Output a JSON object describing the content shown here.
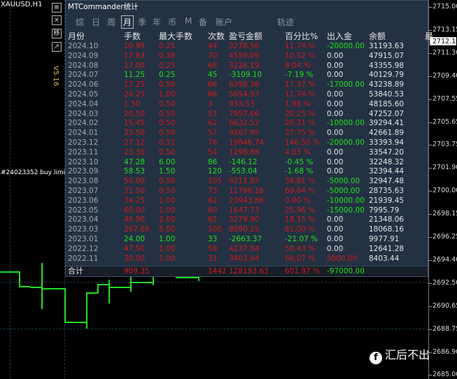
{
  "chart": {
    "symbol": "XAUUSD,H1",
    "version": "V5.16",
    "order_label": "#24023352 buy limit",
    "current_price": "2712.10",
    "price_labels": [
      "2715.00",
      "2713.15",
      "2711.30",
      "2709.40",
      "2707.55",
      "2705.65",
      "2703.75",
      "2701.90",
      "2700.00",
      "2698.15",
      "2696.25",
      "2694.40",
      "2692.50",
      "2690.65",
      "2688.75",
      "2686.90",
      "2685.00"
    ],
    "side_buttons": [
      "≡",
      "×",
      "移",
      "↗"
    ]
  },
  "panel": {
    "title": "MTCommander统计",
    "tabs": [
      "综",
      "日",
      "周",
      "月",
      "季",
      "年",
      "币",
      "M",
      "备",
      "账户",
      "轨迹"
    ],
    "active_tab": "月",
    "headers": [
      "月份",
      "手数",
      "最大手数",
      "次数",
      "盈亏金额",
      "百分比%",
      "出入金",
      "余额",
      "最"
    ],
    "rows": [
      {
        "month": "2024.10",
        "lots": "10.95",
        "max": "0.25",
        "count": "44",
        "pl": "3278.56",
        "pct": "11.74 %",
        "io": "-20000.00",
        "bal": "31193.63",
        "win": false
      },
      {
        "month": "2024.09",
        "lots": "17.63",
        "max": "0.38",
        "count": "70",
        "pl": "4559.09",
        "pct": "10.52 %",
        "io": "0.00",
        "bal": "47915.07",
        "win": false
      },
      {
        "month": "2024.08",
        "lots": "17.00",
        "max": "0.25",
        "count": "68",
        "pl": "3226.19",
        "pct": "8.04 %",
        "io": "0.00",
        "bal": "43355.98",
        "win": false
      },
      {
        "month": "2024.07",
        "lots": "11.25",
        "max": "0.25",
        "count": "45",
        "pl": "-3109.10",
        "pct": "-7.19 %",
        "io": "0.00",
        "bal": "40129.79",
        "win": true
      },
      {
        "month": "2024.06",
        "lots": "17.25",
        "max": "0.50",
        "count": "66",
        "pl": "6398.36",
        "pct": "17.37 %",
        "io": "-17000.00",
        "bal": "43238.89",
        "win": false
      },
      {
        "month": "2024.05",
        "lots": "24.25",
        "max": "1.00",
        "count": "66",
        "pl": "5654.93",
        "pct": "11.74 %",
        "io": "0.00",
        "bal": "53840.53",
        "win": false
      },
      {
        "month": "2024.04",
        "lots": "1.50",
        "max": "0.50",
        "count": "3",
        "pl": "933.53",
        "pct": "1.98 %",
        "io": "0.00",
        "bal": "48185.60",
        "win": false
      },
      {
        "month": "2024.03",
        "lots": "20.50",
        "max": "0.50",
        "count": "53",
        "pl": "7957.66",
        "pct": "20.25 %",
        "io": "0.00",
        "bal": "47252.07",
        "win": false
      },
      {
        "month": "2024.02",
        "lots": "15.45",
        "max": "0.50",
        "count": "62",
        "pl": "6632.52",
        "pct": "20.31 %",
        "io": "-10000.00",
        "bal": "39294.41",
        "win": false
      },
      {
        "month": "2024.01",
        "lots": "25.50",
        "max": "0.50",
        "count": "57",
        "pl": "9267.95",
        "pct": "27.75 %",
        "io": "0.00",
        "bal": "42661.89",
        "win": false
      },
      {
        "month": "2023.12",
        "lots": "27.12",
        "max": "0.52",
        "count": "76",
        "pl": "19846.74",
        "pct": "146.50 %",
        "io": "-20000.00",
        "bal": "33393.94",
        "win": false
      },
      {
        "month": "2023.11",
        "lots": "23.30",
        "max": "0.50",
        "count": "54",
        "pl": "1298.88",
        "pct": "4.03 %",
        "io": "0.00",
        "bal": "33547.20",
        "win": false
      },
      {
        "month": "2023.10",
        "lots": "47.28",
        "max": "6.00",
        "count": "86",
        "pl": "-146.12",
        "pct": "-0.45 %",
        "io": "0.00",
        "bal": "32248.32",
        "win": true
      },
      {
        "month": "2023.09",
        "lots": "58.53",
        "max": "1.50",
        "count": "120",
        "pl": "-553.04",
        "pct": "-1.68 %",
        "io": "0.00",
        "bal": "32394.44",
        "win": true
      },
      {
        "month": "2023.08",
        "lots": "50.00",
        "max": "0.50",
        "count": "105",
        "pl": "9211.85",
        "pct": "38.81 %",
        "io": "-5000.00",
        "bal": "32947.48",
        "win": false
      },
      {
        "month": "2023.07",
        "lots": "31.50",
        "max": "0.50",
        "count": "73",
        "pl": "11796.16",
        "pct": "69.64 %",
        "io": "-5000.00",
        "bal": "28735.63",
        "win": false
      },
      {
        "month": "2023.06",
        "lots": "34.25",
        "max": "1.00",
        "count": "62",
        "pl": "23943.86",
        "pct": "0.00 %",
        "io": "-10000.00",
        "bal": "21939.45",
        "win": false
      },
      {
        "month": "2023.05",
        "lots": "60.00",
        "max": "1.00",
        "count": "60",
        "pl": "1647.73",
        "pct": "25.96 %",
        "io": "-15000.00",
        "bal": "7995.79",
        "win": false
      },
      {
        "month": "2023.04",
        "lots": "46.90",
        "max": "2.00",
        "count": "62",
        "pl": "3279.90",
        "pct": "18.15 %",
        "io": "0.00",
        "bal": "21348.06",
        "win": false
      },
      {
        "month": "2023.03",
        "lots": "267.69",
        "max": "5.00",
        "count": "100",
        "pl": "8090.25",
        "pct": "81.00 %",
        "io": "0.00",
        "bal": "18068.16",
        "win": false
      },
      {
        "month": "2023.01",
        "lots": "24.00",
        "max": "1.00",
        "count": "33",
        "pl": "-2663.37",
        "pct": "-21.07 %",
        "io": "0.00",
        "bal": "9977.91",
        "win": true
      },
      {
        "month": "2022.12",
        "lots": "47.50",
        "max": "1.00",
        "count": "58",
        "pl": "4237.84",
        "pct": "50.43 %",
        "io": "0.00",
        "bal": "12641.28",
        "win": false
      },
      {
        "month": "2022.11",
        "lots": "30.00",
        "max": "1.00",
        "count": "31",
        "pl": "3403.44",
        "pct": "68.07 %",
        "io": "5000.00",
        "bal": "8403.44",
        "win": false
      }
    ],
    "total": {
      "label": "合计",
      "lots": "909.35",
      "count": "1442",
      "pl": "128193.63",
      "pct": "601.97 %",
      "io": "-97000.00"
    }
  },
  "watermark": "汇后不出",
  "colors": {
    "panel_bg": "#233142",
    "profit_red": "#d01c1c",
    "loss_green": "#20e020",
    "candle": "#22dd22"
  }
}
